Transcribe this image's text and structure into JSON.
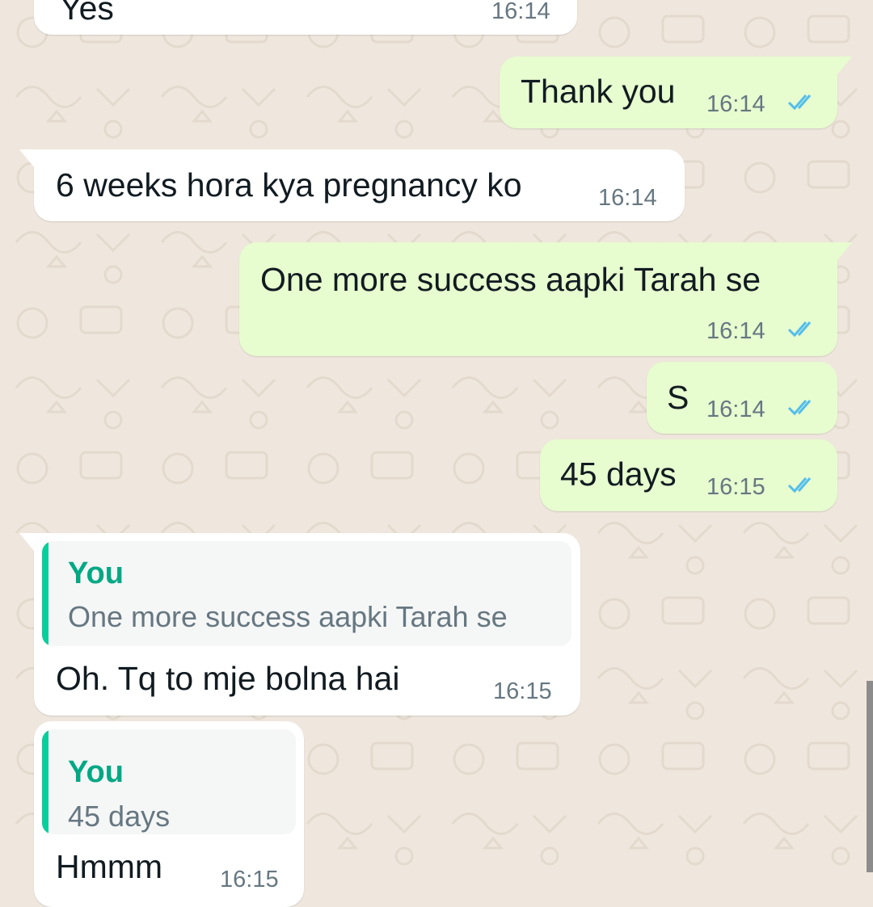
{
  "theme": {
    "chat_background": "#efe7dd",
    "incoming_bubble": "#ffffff",
    "outgoing_bubble": "#e7fccf",
    "read_ticks_color": "#53bdeb",
    "quote_accent": "#06cf9c",
    "quote_author_color": "#00a884"
  },
  "messages": [
    {
      "direction": "in",
      "text": "Yes",
      "time": "16:14"
    },
    {
      "direction": "out",
      "text": "Thank you",
      "time": "16:14",
      "status": "read"
    },
    {
      "direction": "in",
      "text": "6 weeks hora kya pregnancy ko",
      "time": "16:14"
    },
    {
      "direction": "out",
      "text": "One more success aapki Tarah se",
      "time": "16:14",
      "status": "read"
    },
    {
      "direction": "out",
      "text": "S",
      "time": "16:14",
      "status": "read"
    },
    {
      "direction": "out",
      "text": "45 days",
      "time": "16:15",
      "status": "read"
    },
    {
      "direction": "in",
      "text": "Oh.  Tq to mje bolna hai",
      "time": "16:15",
      "reply_to": {
        "author": "You",
        "text": "One more success aapki Tarah se"
      }
    },
    {
      "direction": "in",
      "text": "Hmmm",
      "time": "16:15",
      "reply_to": {
        "author": "You",
        "text": "45 days"
      }
    }
  ]
}
